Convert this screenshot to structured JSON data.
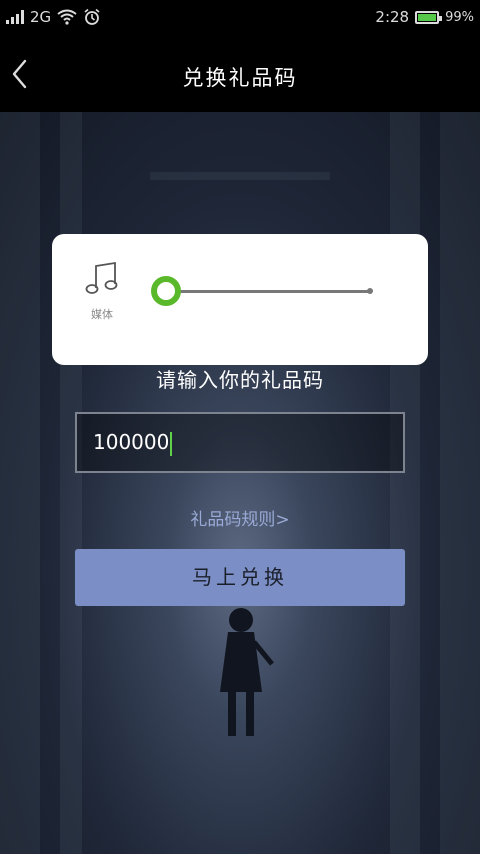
{
  "status_bar": {
    "network": "2G",
    "time": "2:28",
    "battery": "99%",
    "battery_level": 0.99,
    "icons": [
      "signal-icon",
      "wifi-icon",
      "alarm-icon",
      "battery-icon"
    ]
  },
  "header": {
    "title": "兑换礼品码",
    "back_icon": "chevron-left-icon"
  },
  "form": {
    "prompt": "请输入你的礼品码",
    "code_value": "100000",
    "rules_link": "礼品码规则>",
    "submit_label": "马上兑换"
  },
  "volume_panel": {
    "icon": "music-note-icon",
    "label": "媒体",
    "level": 0.0
  },
  "colors": {
    "accent_button": "#7b8fc6",
    "slider_green": "#5ab92a",
    "cursor_green": "#5fd14b",
    "link": "#9aa9d6"
  }
}
